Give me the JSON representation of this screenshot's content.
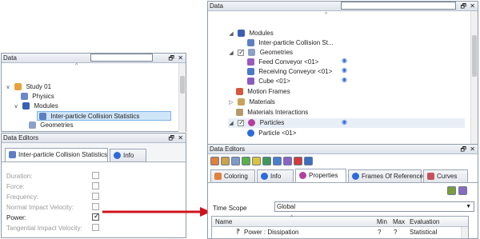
{
  "left": {
    "data_header": "Data",
    "tree": [
      {
        "label": "Study 01"
      },
      {
        "label": "Physics"
      },
      {
        "label": "Modules"
      },
      {
        "label": "Inter-particle Collision Statistics"
      },
      {
        "label": "Geometries"
      }
    ],
    "editors_header": "Data Editors",
    "tabs": [
      "Inter-particle Collision Statistics",
      "Info"
    ],
    "props": [
      {
        "label": "Duration:",
        "checked": false
      },
      {
        "label": "Force:",
        "checked": false
      },
      {
        "label": "Frequency:",
        "checked": false
      },
      {
        "label": "Normal Impact Velocity:",
        "checked": false
      },
      {
        "label": "Power:",
        "checked": true
      },
      {
        "label": "Tangential Impact Velocity:",
        "checked": false
      }
    ]
  },
  "right": {
    "data_header": "Data",
    "tree": [
      {
        "label": "Modules"
      },
      {
        "label": "Inter-particle Collision St..."
      },
      {
        "label": "Geometries"
      },
      {
        "label": "Feed Conveyor <01>"
      },
      {
        "label": "Receiving Conveyor <01>"
      },
      {
        "label": "Cube <01>"
      },
      {
        "label": "Motion Frames"
      },
      {
        "label": "Materials"
      },
      {
        "label": "Materials Interactions"
      },
      {
        "label": "Particles"
      },
      {
        "label": "Particle <01>"
      }
    ],
    "editors_header": "Data Editors",
    "tabs": [
      "Coloring",
      "Info",
      "Properties",
      "Frames Of Reference",
      "Curves"
    ],
    "time_scope_label": "Time Scope",
    "time_scope_value": "Global",
    "table_headers": [
      "Name",
      "Min",
      "Max",
      "Evaluation"
    ],
    "table_row": {
      "name": "Power : Dissipation",
      "min": "?",
      "max": "?",
      "evaluation": "Statistical"
    }
  },
  "colors": {
    "arrow": "#d0141c",
    "selection": "#cfe4f7",
    "accent": "#2f6bd8"
  }
}
